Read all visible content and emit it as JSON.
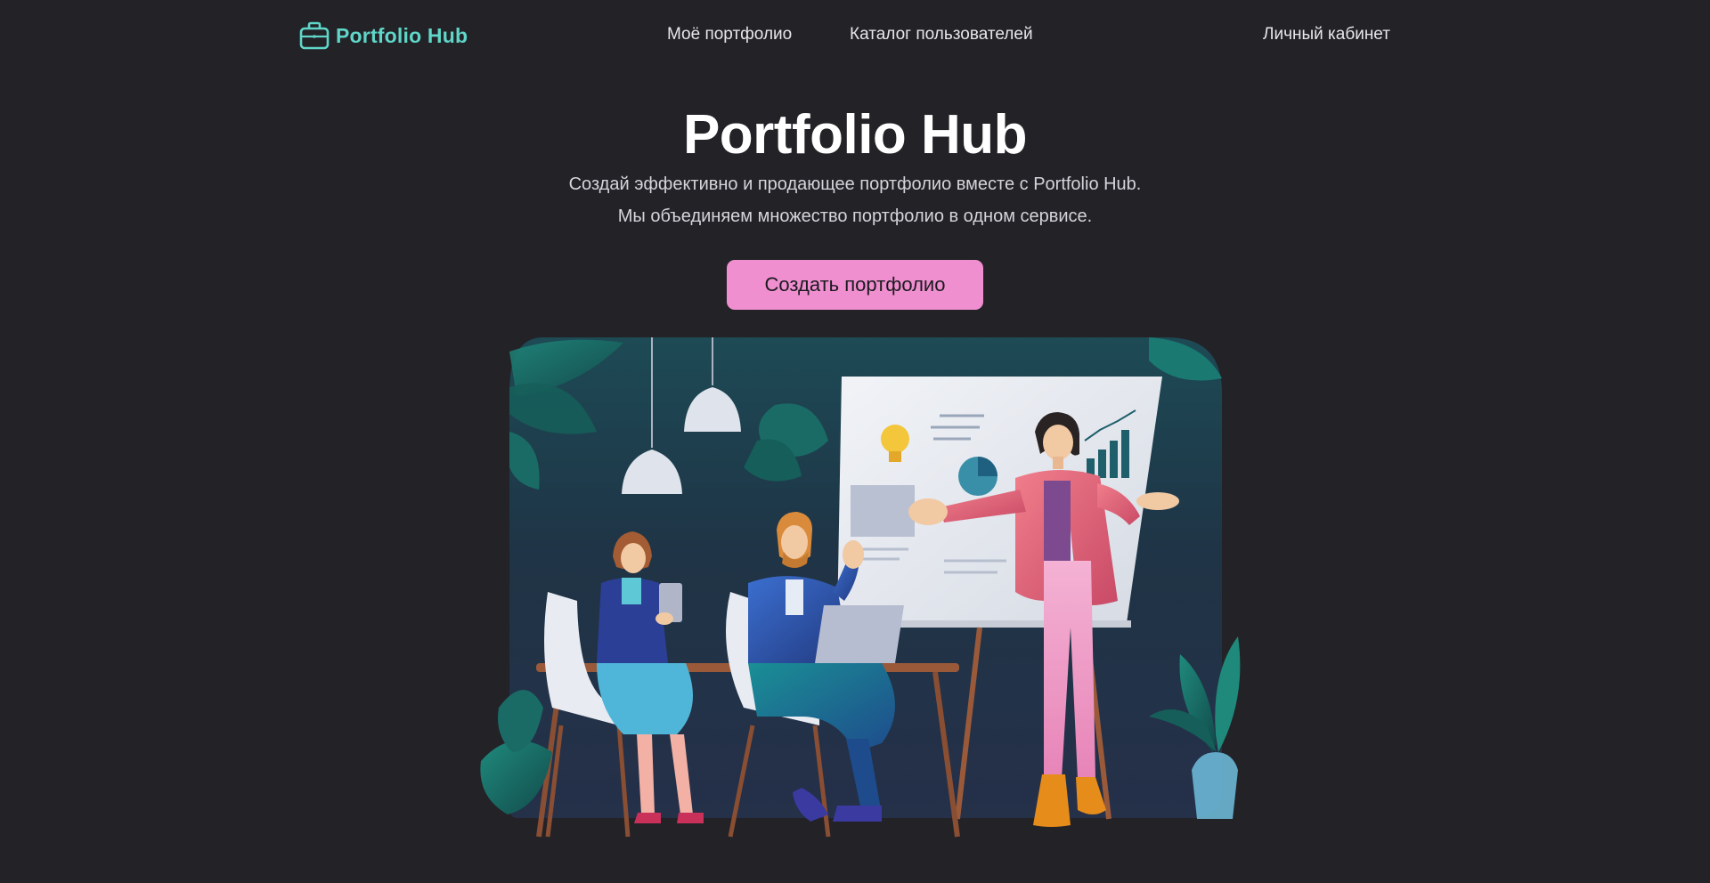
{
  "navbar": {
    "brand": {
      "icon": "briefcase-icon",
      "name": "Portfolio Hub",
      "color": "#5fd6c8"
    },
    "links": {
      "my_portfolio": "Моё портфолио",
      "catalog": "Каталог пользователей",
      "account": "Личный кабинет"
    }
  },
  "hero": {
    "title": "Portfolio Hub",
    "subtitle_line_1": "Создай эффективно и продающее портфолио вместе с Portfolio Hub.",
    "subtitle_line_2": "Мы объединяем множество портфолио в одном сервисе.",
    "cta_label": "Создать портфолио",
    "cta_color": "#ef8fcf"
  },
  "illustration": {
    "subject": "team-meeting-presentation",
    "colors": {
      "background": "#232227",
      "panel": "#1f3446",
      "leaf": "#1a6b66",
      "presenter_jacket": "#e0657a",
      "presenter_pants": "#f0a0c8",
      "board": "#e8ecf2"
    }
  }
}
